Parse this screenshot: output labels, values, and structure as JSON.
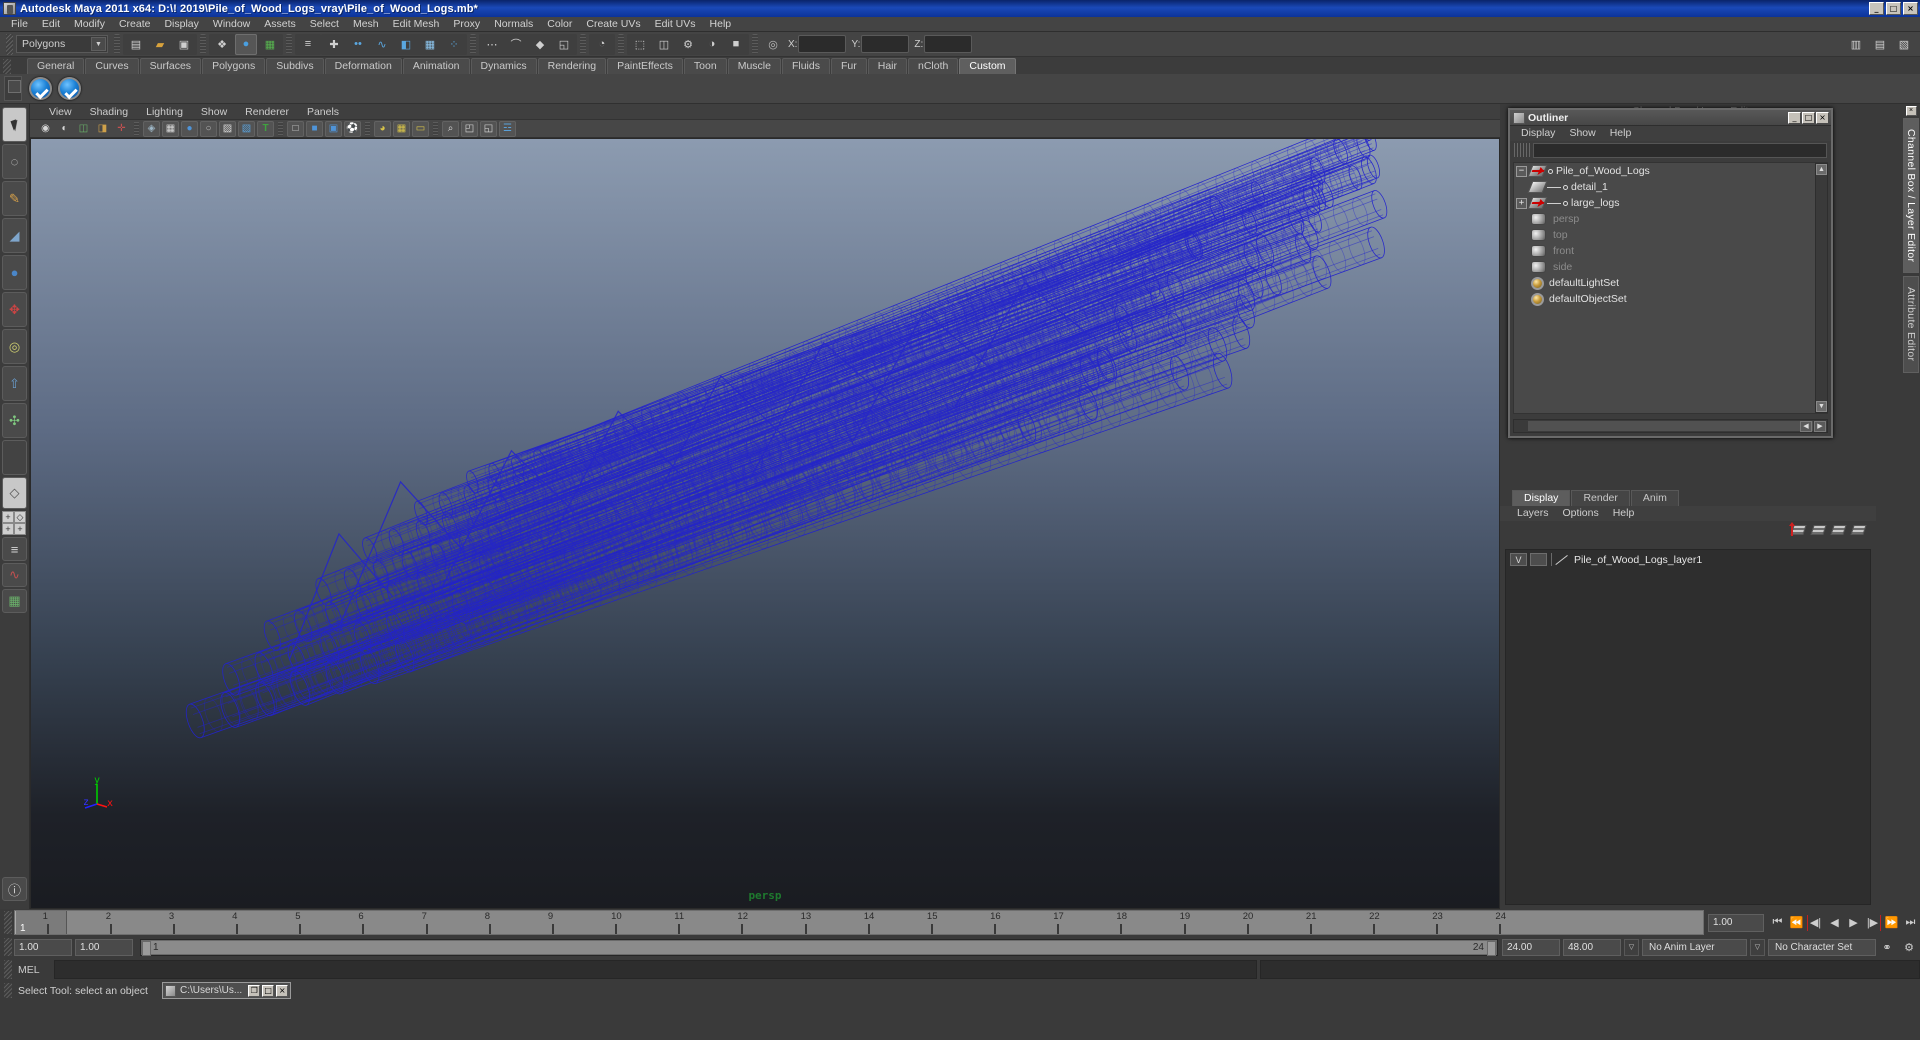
{
  "window": {
    "title": "Autodesk Maya 2011 x64: D:\\! 2019\\Pile_of_Wood_Logs_vray\\Pile_of_Wood_Logs.mb*",
    "min_label": "_",
    "max_label": "□",
    "close_label": "×"
  },
  "menubar": {
    "items": [
      "File",
      "Edit",
      "Modify",
      "Create",
      "Display",
      "Window",
      "Assets",
      "Select",
      "Mesh",
      "Edit Mesh",
      "Proxy",
      "Normals",
      "Color",
      "Create UVs",
      "Edit UVs",
      "Help"
    ]
  },
  "statusline": {
    "mode_value": "Polygons",
    "mode_arrow": "▼",
    "x_label": "X:",
    "y_label": "Y:",
    "z_label": "Z:",
    "x_value": "",
    "y_value": "",
    "z_value": "",
    "icons": [
      {
        "name": "new-scene-icon",
        "glyph": "▤"
      },
      {
        "name": "open-scene-icon",
        "glyph": "▰"
      },
      {
        "name": "save-scene-icon",
        "glyph": "▣"
      },
      {
        "name": "select-by-hierarchy-icon",
        "glyph": "❖"
      },
      {
        "name": "select-by-object-type-icon",
        "glyph": "●"
      },
      {
        "name": "select-by-component-type-icon",
        "glyph": "▦"
      },
      {
        "name": "component-mask-icon",
        "glyph": "≡"
      },
      {
        "name": "vertex-mask-icon",
        "glyph": "✚"
      },
      {
        "name": "edge-mask-icon",
        "glyph": "••"
      },
      {
        "name": "curve-mask-icon",
        "glyph": "∿"
      },
      {
        "name": "face-mask-icon",
        "glyph": "◧"
      },
      {
        "name": "uv-mask-icon",
        "glyph": "▦"
      },
      {
        "name": "particle-mask-icon",
        "glyph": "⁘"
      },
      {
        "name": "snap-to-grid-icon",
        "glyph": "⋯"
      },
      {
        "name": "snap-to-curve-icon",
        "glyph": "⌒"
      },
      {
        "name": "snap-to-point-icon",
        "glyph": "◆"
      },
      {
        "name": "snap-to-view-plane-icon",
        "glyph": "◱"
      },
      {
        "name": "construction-history-icon",
        "glyph": "◔"
      },
      {
        "name": "render-current-frame-icon",
        "glyph": "⬚"
      },
      {
        "name": "ipr-render-icon",
        "glyph": "◫"
      },
      {
        "name": "render-settings-icon",
        "glyph": "⚙"
      },
      {
        "name": "hypershade-icon",
        "glyph": "◑"
      },
      {
        "name": "render-view-icon",
        "glyph": "■"
      }
    ],
    "right_icons": [
      {
        "name": "show-hide-channel-box-icon",
        "glyph": "▥"
      },
      {
        "name": "show-hide-layer-editor-icon",
        "glyph": "▤"
      },
      {
        "name": "show-hide-attribute-editor-icon",
        "glyph": "▧"
      }
    ]
  },
  "shelf": {
    "tabs": [
      "General",
      "Curves",
      "Surfaces",
      "Polygons",
      "Subdivs",
      "Deformation",
      "Animation",
      "Dynamics",
      "Rendering",
      "PaintEffects",
      "Toon",
      "Muscle",
      "Fluids",
      "Fur",
      "Hair",
      "nCloth",
      "Custom"
    ],
    "selected_tab": "Custom",
    "buttons": [
      {
        "name": "shelf-check-button-1",
        "label": "check"
      },
      {
        "name": "shelf-check-button-2",
        "label": "check"
      }
    ]
  },
  "toolbox": {
    "items": [
      {
        "name": "select-tool",
        "glyph": "arrow",
        "selected": true
      },
      {
        "name": "lasso-tool",
        "glyph": "⌁"
      },
      {
        "name": "paint-selection-tool",
        "glyph": "✎"
      },
      {
        "name": "sculpt-tool",
        "glyph": "◢"
      },
      {
        "name": "soft-modification-tool",
        "glyph": "●"
      },
      {
        "name": "move-tool",
        "glyph": "✥"
      },
      {
        "name": "rotate-tool",
        "glyph": "◌"
      },
      {
        "name": "scale-tool",
        "glyph": "⤢"
      },
      {
        "name": "last-tool-used",
        "glyph": "✣"
      },
      {
        "name": "blank-tool-slot",
        "glyph": ""
      }
    ],
    "layouts": [
      {
        "name": "single-perspective-view-layout",
        "glyph": "◇"
      },
      {
        "name": "four-view-layout",
        "glyph": "⊞"
      },
      {
        "name": "outliner-persp-layout",
        "glyph": "≡"
      },
      {
        "name": "persp-graph-layout",
        "glyph": "∿"
      },
      {
        "name": "hypershade-persp-layout",
        "glyph": "▦"
      }
    ]
  },
  "viewport": {
    "menus": [
      "View",
      "Shading",
      "Lighting",
      "Show",
      "Renderer",
      "Panels"
    ],
    "camera_label": "persp",
    "axis": {
      "x": "x",
      "y": "y",
      "z": "z"
    },
    "icon_groups": [
      [
        {
          "name": "select-camera-icon",
          "glyph": "◉"
        },
        {
          "name": "camera-attributes-icon",
          "glyph": "◐"
        },
        {
          "name": "bookmark-icon",
          "glyph": "◫"
        },
        {
          "name": "image-plane-icon",
          "glyph": "◨"
        },
        {
          "name": "two-d-pan-zoom-icon",
          "glyph": "✛"
        }
      ],
      [
        {
          "name": "wireframe-shading-icon",
          "glyph": "◈"
        },
        {
          "name": "smooth-shade-all-icon",
          "glyph": "▦"
        },
        {
          "name": "smooth-shade-selected-icon",
          "glyph": "●"
        },
        {
          "name": "flat-shade-icon",
          "glyph": "○"
        },
        {
          "name": "shaded-wireframe-icon",
          "glyph": "▨"
        },
        {
          "name": "textured-icon",
          "glyph": "▧"
        },
        {
          "name": "use-default-lighting-icon",
          "glyph": "T"
        }
      ],
      [
        {
          "name": "xray-icon",
          "glyph": "□"
        },
        {
          "name": "xray-joints-icon",
          "glyph": "■"
        },
        {
          "name": "shadows-icon",
          "glyph": "▣"
        },
        {
          "name": "high-quality-render-icon",
          "glyph": "⚽"
        }
      ],
      [
        {
          "name": "isolate-select-icon",
          "glyph": "◕"
        },
        {
          "name": "grid-display-icon",
          "glyph": "▦"
        },
        {
          "name": "film-gate-icon",
          "glyph": "▭"
        },
        {
          "name": "resolution-gate-icon",
          "glyph": "▬"
        },
        {
          "name": "gate-mask-icon",
          "glyph": "▤"
        },
        {
          "name": "exposure-icon",
          "glyph": "●"
        },
        {
          "name": "gamma-icon",
          "glyph": "◑"
        },
        {
          "name": "view-transform-icon",
          "glyph": "○"
        }
      ],
      [
        {
          "name": "panel-zoom-icon",
          "glyph": "⌕"
        },
        {
          "name": "panel-snapshot-icon",
          "glyph": "◰"
        },
        {
          "name": "panel-tear-off-icon",
          "glyph": "◱"
        },
        {
          "name": "panel-share-icon",
          "glyph": "☲"
        }
      ]
    ]
  },
  "outliner": {
    "title": "Outliner",
    "win_min": "_",
    "win_max": "□",
    "win_close": "×",
    "menus": [
      "Display",
      "Show",
      "Help"
    ],
    "search_value": "",
    "scroll_up": "▲",
    "scroll_down": "▼",
    "scroll_left": "◀",
    "scroll_right": "▶",
    "items": [
      {
        "label": "Pile_of_Wood_Logs",
        "icon": "mesh-arrow-icon",
        "expander": "−",
        "indent": 0,
        "dim": false,
        "dot": true
      },
      {
        "label": "detail_1",
        "icon": "mesh-icon",
        "expander": "",
        "indent": 1,
        "dim": false,
        "dot": true
      },
      {
        "label": "large_logs",
        "icon": "mesh-arrow-icon",
        "expander": "+",
        "indent": 1,
        "dim": false,
        "dot": true
      },
      {
        "label": "persp",
        "icon": "camera-icon",
        "expander": "",
        "indent": 0,
        "dim": true,
        "dot": false
      },
      {
        "label": "top",
        "icon": "camera-icon",
        "expander": "",
        "indent": 0,
        "dim": true,
        "dot": false
      },
      {
        "label": "front",
        "icon": "camera-icon",
        "expander": "",
        "indent": 0,
        "dim": true,
        "dot": false
      },
      {
        "label": "side",
        "icon": "camera-icon",
        "expander": "",
        "indent": 0,
        "dim": true,
        "dot": false
      },
      {
        "label": "defaultLightSet",
        "icon": "set-icon",
        "expander": "",
        "indent": 0,
        "dim": false,
        "dot": false
      },
      {
        "label": "defaultObjectSet",
        "icon": "set-icon",
        "expander": "",
        "indent": 0,
        "dim": false,
        "dot": false
      }
    ]
  },
  "channelbox_header": "Channel Box / Layer Editor",
  "layer_editor": {
    "tabs": [
      "Display",
      "Render",
      "Anim"
    ],
    "selected_tab": "Display",
    "menus": [
      "Layers",
      "Options",
      "Help"
    ],
    "new_layer_icon": "new-layer-icon",
    "layers": [
      {
        "visibility": "V",
        "name": "Pile_of_Wood_Logs_layer1"
      }
    ]
  },
  "right_tabs": {
    "items": [
      "Channel Box / Layer Editor",
      "Attribute Editor"
    ],
    "selected": "Channel Box / Layer Editor"
  },
  "time_slider": {
    "ticks": [
      "1",
      "2",
      "3",
      "4",
      "5",
      "6",
      "7",
      "8",
      "9",
      "10",
      "11",
      "12",
      "13",
      "14",
      "15",
      "16",
      "17",
      "18",
      "19",
      "20",
      "21",
      "22",
      "23",
      "24"
    ],
    "current_frame": "1",
    "current_field": "1.00",
    "playback_buttons": [
      {
        "name": "go-to-start-button",
        "glyph": "⏮"
      },
      {
        "name": "step-back-keyframe-button",
        "glyph": "⏪"
      },
      {
        "name": "step-back-frame-button",
        "glyph": "◀|"
      },
      {
        "name": "play-backwards-button",
        "glyph": "◀"
      },
      {
        "name": "play-forwards-button",
        "glyph": "▶"
      },
      {
        "name": "step-forward-frame-button",
        "glyph": "|▶"
      },
      {
        "name": "step-forward-keyframe-button",
        "glyph": "⏩"
      },
      {
        "name": "go-to-end-button",
        "glyph": "⏭"
      }
    ]
  },
  "range_slider": {
    "anim_start": "1.00",
    "range_start": "1.00",
    "bar_start": "1",
    "bar_end": "24",
    "range_end": "24.00",
    "anim_end": "48.00",
    "anim_layer": "No Anim Layer",
    "character_set": "No Character Set",
    "dropdown_glyph": "▽",
    "auto_key_icon": "auto-key-icon",
    "anim_prefs_icon": "animation-preferences-icon"
  },
  "command_line": {
    "label": "MEL",
    "value": "",
    "placeholder": ""
  },
  "help_line": {
    "text": "Select Tool: select an object",
    "taskbar_item": "C:\\Users\\Us...",
    "taskbar_restore": "❐",
    "taskbar_max": "□",
    "taskbar_close": "×"
  },
  "colors": {
    "title_blue": "#0c3399",
    "panel_gray": "#3a3a3a",
    "wireframe_blue": "#2020c8",
    "persp_green": "#1e7a2e",
    "axis_x": "#ff0000",
    "axis_y": "#00cc00",
    "axis_z": "#0000ff"
  }
}
